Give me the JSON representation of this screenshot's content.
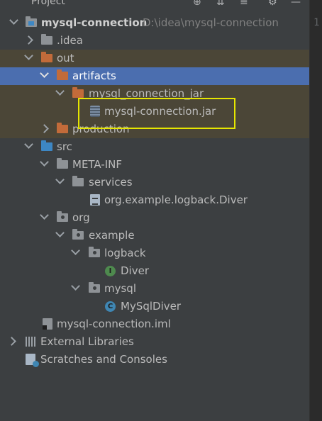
{
  "panel": {
    "title": "Project",
    "line_number": "1"
  },
  "tree": {
    "root": {
      "label": "mysql-connection",
      "path": "D:\\idea\\mysql-connection"
    },
    "idea": "idea",
    "idea_prefix": ".",
    "out": "out",
    "artifacts": "artifacts",
    "artifact_jar_folder": "mysql_connection_jar",
    "jar_file": "mysql-connection.jar",
    "production": "production",
    "src": "src",
    "meta_inf": "META-INF",
    "services": "services",
    "service_file": "org.example.logback.Diver",
    "org": "org",
    "example": "example",
    "logback": "logback",
    "diver": "Diver",
    "mysql": "mysql",
    "mysqldiver": "MySqlDiver",
    "iml": "mysql-connection.iml",
    "external_libraries": "External Libraries",
    "scratches": "Scratches and Consoles"
  },
  "icon_letters": {
    "interface": "I",
    "class": "C"
  },
  "colors": {
    "selection": "#4b6eaf",
    "highlight_box": "#e6e600",
    "folder_orange": "#c26b3a",
    "folder_blue": "#3d87c4"
  }
}
